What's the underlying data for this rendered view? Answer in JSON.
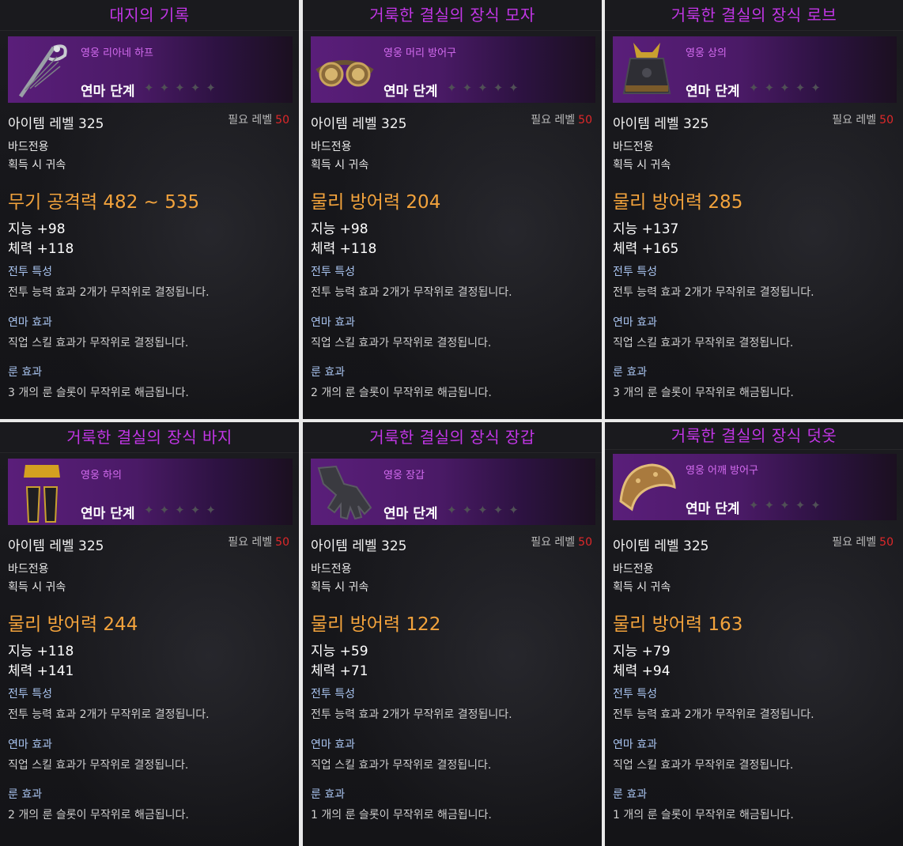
{
  "common": {
    "item_level": "아이템 레벨 325",
    "req_label": "필요 레벨",
    "req_value": "50",
    "class_req": "바드전용",
    "bind": "획득 시 귀속",
    "enhance": "연마 단계",
    "combat_header": "전투 특성",
    "combat_desc": "전투 능력 효과 2개가 무작위로 결정됩니다.",
    "refine_header": "연마 효과",
    "refine_desc": "직업 스킬 효과가 무작위로 결정됩니다.",
    "rune_header": "룬 효과"
  },
  "cards": [
    {
      "title": "대지의 기록",
      "grade": "영웅 리아네 하프",
      "main_stat": "무기 공격력 482 ~ 535",
      "stat1": "지능 +98",
      "stat2": "체력 +118",
      "rune_desc": "3 개의 룬 슬롯이 무작위로 해금됩니다.",
      "icon": "harp-icon"
    },
    {
      "title": "거룩한 결실의 장식 모자",
      "grade": "영웅 머리 방어구",
      "main_stat": "물리 방어력 204",
      "stat1": "지능 +98",
      "stat2": "체력 +118",
      "rune_desc": "2 개의 룬 슬롯이 무작위로 해금됩니다.",
      "icon": "goggles-icon"
    },
    {
      "title": "거룩한 결실의 장식 로브",
      "grade": "영웅 상의",
      "main_stat": "물리 방어력 285",
      "stat1": "지능 +137",
      "stat2": "체력 +165",
      "rune_desc": "3 개의 룬 슬롯이 무작위로 해금됩니다.",
      "icon": "robe-icon"
    },
    {
      "title": "거룩한 결실의 장식 바지",
      "grade": "영웅 하의",
      "main_stat": "물리 방어력 244",
      "stat1": "지능 +118",
      "stat2": "체력 +141",
      "rune_desc": "2 개의 룬 슬롯이 무작위로 해금됩니다.",
      "icon": "pants-icon"
    },
    {
      "title": "거룩한 결실의 장식 장갑",
      "grade": "영웅 장갑",
      "main_stat": "물리 방어력 122",
      "stat1": "지능 +59",
      "stat2": "체력 +71",
      "rune_desc": "1 개의 룬 슬롯이 무작위로 해금됩니다.",
      "icon": "glove-icon"
    },
    {
      "title": "거룩한 결실의 장식 덧옷",
      "grade": "영웅 어깨 방어구",
      "main_stat": "물리 방어력 163",
      "stat1": "지능 +79",
      "stat2": "체력 +94",
      "rune_desc": "1 개의 룬 슬롯이 무작위로 해금됩니다.",
      "icon": "shoulder-icon"
    }
  ],
  "colors": {
    "title": "#c236e6",
    "grade": "#d46cf0",
    "main_stat": "#f3a33c",
    "req_value": "#e0282a",
    "header": "#a9c4f0"
  }
}
